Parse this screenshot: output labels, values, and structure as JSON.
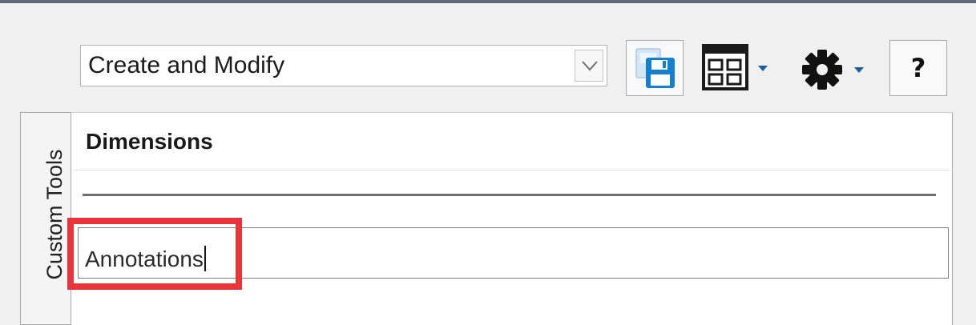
{
  "toolbar": {
    "preset_select": {
      "value": "Create and Modify"
    },
    "help_label": "?"
  },
  "side_tabs": {
    "custom_tools_label": "Custom Tools"
  },
  "panel": {
    "group_heading": "Dimensions",
    "name_input": {
      "value": "Annotations"
    }
  },
  "icons": {
    "preset_dropdown": "chevron-down-icon",
    "save": "save-icon",
    "layout": "layout-icon",
    "settings": "gear-icon"
  },
  "colors": {
    "highlight": "#e8353b",
    "save_icon_blue": "#1580d3",
    "background": "#f0f0f0"
  }
}
